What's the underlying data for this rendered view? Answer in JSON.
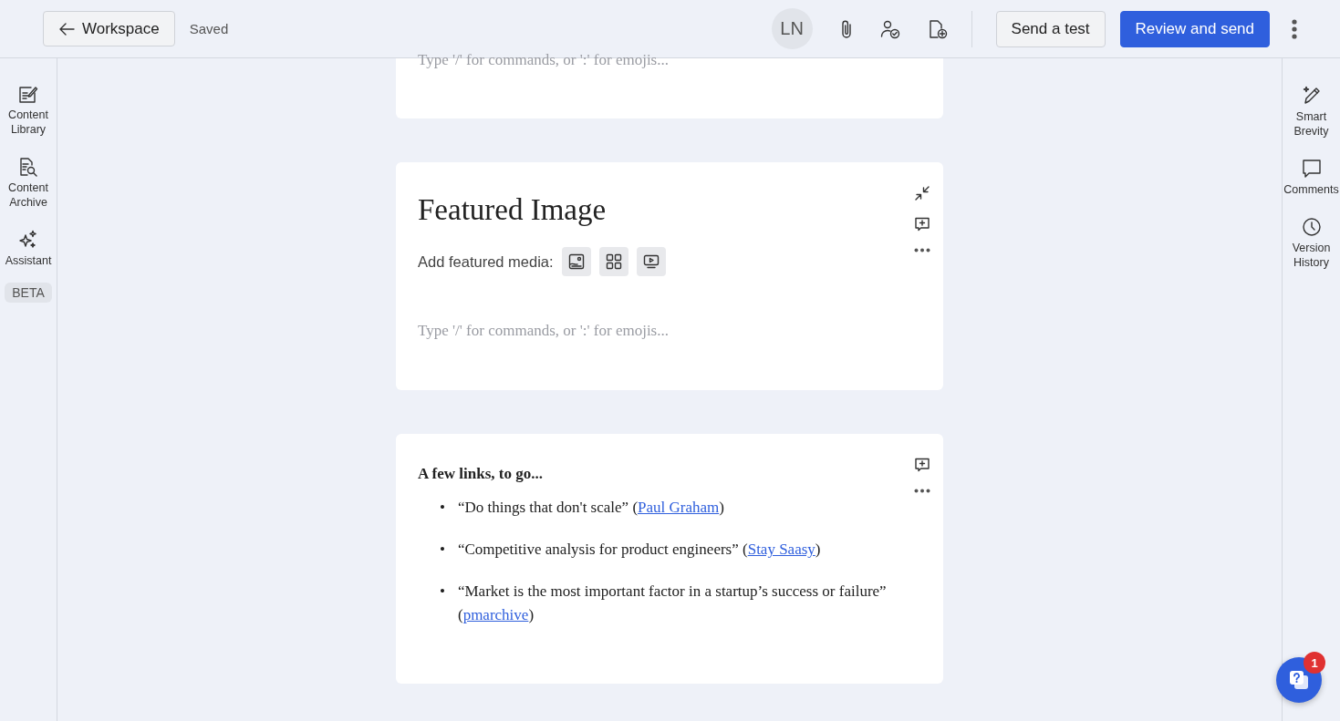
{
  "header": {
    "back_button": "Workspace",
    "save_status": "Saved",
    "avatar": "LN",
    "buttons": [
      {
        "label": "Send a test",
        "kind": "secondary"
      },
      {
        "label": "Review and send",
        "kind": "primary"
      }
    ]
  },
  "left_sidebar": [
    {
      "label": "Content Library"
    },
    {
      "label": "Content Archive"
    },
    {
      "label": "Assistant",
      "badge": "BETA"
    }
  ],
  "right_sidebar": [
    {
      "label": "Smart Brevity"
    },
    {
      "label": "Comments"
    },
    {
      "label": "Version History"
    }
  ],
  "blocks": [
    {
      "kind": "text",
      "placeholder": "Type '/' for commands, or ':' for emojis..."
    },
    {
      "kind": "featured",
      "title": "Featured Image",
      "media_label": "Add featured media:",
      "placeholder": "Type '/' for commands, or ':' for emojis..."
    },
    {
      "kind": "links",
      "heading": "A few links, to go...",
      "items": [
        {
          "marker": "•",
          "text": "“Do things that don't scale” (",
          "link": "Paul Graham",
          "after": ")"
        },
        {
          "marker": "•",
          "text": "“Competitive analysis for product engineers” (",
          "link": "Stay Saasy",
          "after": ")"
        },
        {
          "marker": "•",
          "text": "“Market is the most important factor in a startup’s success or failure” (",
          "link": "pmarchive",
          "after": ")"
        }
      ]
    }
  ],
  "help": {
    "badge": "1"
  }
}
